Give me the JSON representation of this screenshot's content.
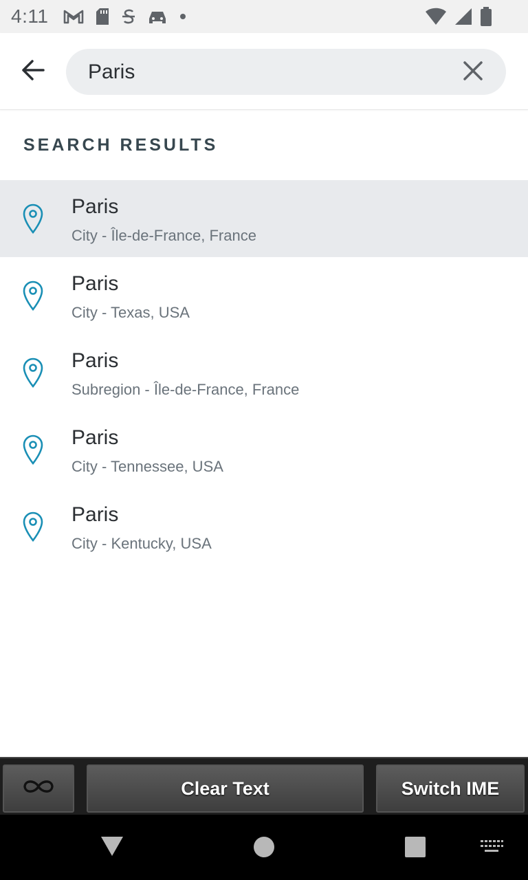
{
  "status_bar": {
    "time": "4:11",
    "left_icons": [
      "gmail-icon",
      "sd-card-icon",
      "s-badge-icon",
      "car-icon",
      "dot-icon"
    ],
    "right_icons": [
      "wifi-icon",
      "signal-icon",
      "battery-icon"
    ]
  },
  "search": {
    "value": "Paris",
    "back_icon": "arrow-left-icon",
    "clear_icon": "close-icon"
  },
  "section": {
    "title": "SEARCH RESULTS"
  },
  "results": [
    {
      "title": "Paris",
      "subtitle": "City - Île-de-France, France",
      "selected": true
    },
    {
      "title": "Paris",
      "subtitle": "City - Texas, USA",
      "selected": false
    },
    {
      "title": "Paris",
      "subtitle": "Subregion - Île-de-France, France",
      "selected": false
    },
    {
      "title": "Paris",
      "subtitle": "City - Tennessee, USA",
      "selected": false
    },
    {
      "title": "Paris",
      "subtitle": "City - Kentucky, USA",
      "selected": false
    }
  ],
  "helper_bar": {
    "infinity_icon": "infinity-icon",
    "clear_text_label": "Clear Text",
    "switch_ime_label": "Switch IME"
  },
  "nav_bar": {
    "icons": [
      "nav-back-icon",
      "nav-home-icon",
      "nav-recents-icon",
      "keyboard-icon"
    ]
  },
  "colors": {
    "accent_pin": "#1a8fb5",
    "selected_row": "#e8eaed",
    "search_pill": "#eceef0",
    "section_title": "#37474f"
  }
}
